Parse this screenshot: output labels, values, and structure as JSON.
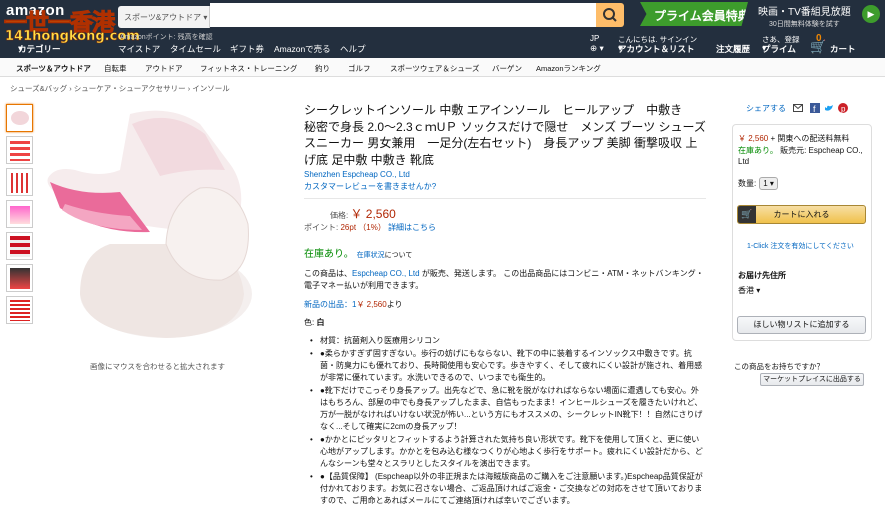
{
  "header": {
    "logo": "amazon",
    "watermark_top": "一世一香港",
    "watermark_bottom": "141hongkong.com",
    "category_dropdown": "スポーツ&アウトドア",
    "prime_banner": "プライム会員特典",
    "promo_title": "映画・TV番組見放題",
    "promo_sub": "30日間無料体験を試す",
    "delivery_text": "Amazonポイント: 残高を確認",
    "nav": {
      "category": "カテゴリー",
      "mystore": "マイストア",
      "timesale": "タイムセール",
      "giftcard": "ギフト券",
      "sell": "Amazonで売る",
      "help": "ヘルプ",
      "lang": "JP",
      "account_top": "こんにちは. サインイン",
      "account": "アカウント＆リスト",
      "orders": "注文履歴",
      "prime_top": "さあ、登録",
      "prime": "プライム",
      "cart_count": "0",
      "cart": "カート"
    }
  },
  "subnav": [
    "スポーツ＆アウトドア",
    "自転車",
    "アウトドア",
    "フィットネス・トレーニング",
    "釣り",
    "ゴルフ",
    "スポーツウェア＆シューズ",
    "バーゲン",
    "Amazonランキング"
  ],
  "breadcrumb": "シューズ&バッグ › シューケア・シューアクセサリー › インソール",
  "image_hint": "画像にマウスを合わせると拡大されます",
  "product": {
    "title": "シークレットインソール 中敷 エアインソール　ヒールアップ　中敷き　秘密で身長 2.0〜2.3ｃｍUＰ ソックスだけで隠せ　メンズ ブーツ シューズ スニーカー 男女兼用　一足分(左右セット)　身長アップ 美脚 衝撃吸収 上げ底 足中敷 中敷き 靴底",
    "brand": "Shenzhen Espcheap CO., Ltd",
    "review_link": "カスタマーレビューを書きませんか?",
    "price_label": "価格:",
    "price": "￥ 2,560",
    "points_label": "ポイント:",
    "points": "26pt （1%）",
    "points_link": "詳細はこちら",
    "stock": "在庫あり。",
    "stock_link": "在庫状況",
    "stock_suffix": "について",
    "seller_pre": "この商品は、",
    "seller_link": "Espcheap CO., Ltd",
    "seller_post": " が販売、発送します。 この出品商品にはコンビニ・ATM・ネットバンキング・電子マネー払いが利用できます。",
    "new_label": "新品の出品：1",
    "new_price": "￥ 2,560",
    "new_suffix": "より",
    "color_label": "色:",
    "color_value": "白",
    "bullets": [
      "材質：抗菌剤入り医療用シリコン",
      "●柔らかすぎず固すぎない。歩行の妨げにもならない、靴下の中に装着するインソックス中敷きです。抗菌・防臭力にも優れており、長時間使用も安心です。歩きやすく、そして疲れにくい設計が施され、着用感が非常に優れています。水洗いできるので、いつまでも衛生的。",
      "●靴下だけでこっそり身長アップ。出先などで、急に靴を脱がなければならない場面に遭遇しても安心。外はもちろん、部屋の中でも身長アップしたまま、自信もったまま！インヒールシューズを履きたいけれど、万が一脱がなければいけない状況が怖い...という方にもオススメの、シークレットIN靴下！！自然にさりげなく...そして確実に2cmの身長アップ！",
      "●かかとにピッタリとフィットするよう計算された気持ち良い形状です。靴下を使用して頂くと、更に使い心地がアップします。かかとを包み込む様なつくりが心地よく歩行をサポート。疲れにくい設計だから、どんなシーンも堂々とスラリとしたスタイルを演出できます。",
      "●【品質保障】 (Espcheap以外の非正規または海賊版商品のご購入をご注意願います。)Espcheap品質保証が付かれております。お気に召さない場合、ご返品頂ければご返金・ご交換などの対応をさせて頂いておりますので、ご用命とあればメールにてご連絡頂ければ幸いでございます。"
    ]
  },
  "buybox": {
    "share": "シェアする",
    "price": "￥ 2,560",
    "price_suffix": " + 関東への配送料無料",
    "stock": "在庫あり。",
    "seller": " 販売元: Espcheap CO., Ltd",
    "qty_label": "数量:",
    "qty_value": "1",
    "add_to_cart": "カートに入れる",
    "oneclick": "1-Click 注文を有効にしてください",
    "ship_to_label": "お届け先住所",
    "ship_to": "香港",
    "wishlist": "ほしい物リストに追加する",
    "sell_q": "この商品をお持ちですか？",
    "sell_btn": "マーケットプレイスに出品する"
  },
  "colors": {
    "header_bg": "#232f3e",
    "price": "#b12704",
    "link": "#0066c0",
    "stock": "#008a00",
    "prime": "#3d9c2c"
  }
}
